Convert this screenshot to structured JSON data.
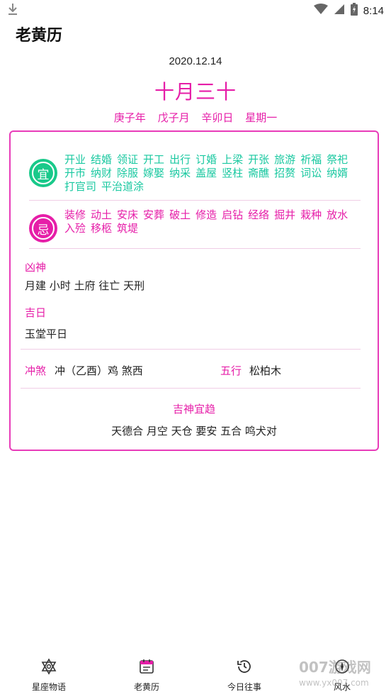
{
  "status_bar": {
    "time": "8:14"
  },
  "app_title": "老黄历",
  "solar_date": "2020.12.14",
  "lunar_date": "十月三十",
  "ganzhi": {
    "year": "庚子年",
    "month": "戊子月",
    "day": "辛卯日",
    "weekday": "星期一"
  },
  "yi": {
    "badge": "宜",
    "items": [
      "开业",
      "结婚",
      "领证",
      "开工",
      "出行",
      "订婚",
      "上梁",
      "开张",
      "旅游",
      "祈福",
      "祭祀",
      "开市",
      "纳财",
      "除服",
      "嫁娶",
      "纳采",
      "盖屋",
      "竖柱",
      "斋醮",
      "招赘",
      "词讼",
      "纳婿",
      "打官司",
      "平治道涂"
    ]
  },
  "ji": {
    "badge": "忌",
    "items": [
      "装修",
      "动土",
      "安床",
      "安葬",
      "破土",
      "修造",
      "启钻",
      "经络",
      "掘井",
      "栽种",
      "放水",
      "入殓",
      "移柩",
      "筑堤"
    ]
  },
  "xiongshen": {
    "label": "凶神",
    "value": "月建 小时 土府 往亡 天刑"
  },
  "jiri": {
    "label": "吉日",
    "value": "玉堂平日"
  },
  "chongsha": {
    "label": "冲煞",
    "value": "冲（乙酉）鸡 煞西"
  },
  "wuxing": {
    "label": "五行",
    "value": "松柏木"
  },
  "jishen": {
    "label": "吉神宜趋",
    "value": "天德合 月空 天仓 要安 五合 鸣犬对"
  },
  "nav": [
    {
      "label": "星座物语",
      "icon": "star-of-david-icon"
    },
    {
      "label": "老黄历",
      "icon": "calendar-icon"
    },
    {
      "label": "今日往事",
      "icon": "history-clock-icon"
    },
    {
      "label": "风水",
      "icon": "compass-icon"
    }
  ],
  "watermark": {
    "text": "007游戏网",
    "url": "www.yx007.com"
  },
  "colors": {
    "accent_pink": "#e61ea8",
    "accent_green": "#19c98a",
    "border_pink": "#e83cb9"
  }
}
